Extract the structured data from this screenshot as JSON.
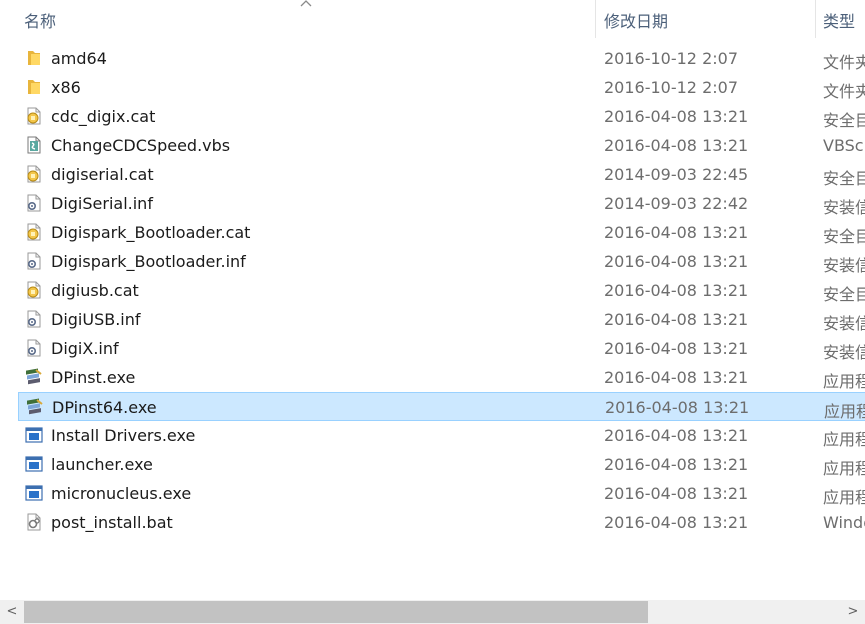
{
  "columns": {
    "name": "名称",
    "date": "修改日期",
    "type": "类型"
  },
  "files": [
    {
      "name": "amd64",
      "date": "2016-10-12 2:07",
      "type": "文件夹",
      "icon": "folder-icon"
    },
    {
      "name": "x86",
      "date": "2016-10-12 2:07",
      "type": "文件夹",
      "icon": "folder-icon"
    },
    {
      "name": "cdc_digix.cat",
      "date": "2016-04-08 13:21",
      "type": "安全目录",
      "icon": "security-catalog-icon"
    },
    {
      "name": "ChangeCDCSpeed.vbs",
      "date": "2016-04-08 13:21",
      "type": "VBScript",
      "icon": "vbscript-icon"
    },
    {
      "name": "digiserial.cat",
      "date": "2014-09-03 22:45",
      "type": "安全目录",
      "icon": "security-catalog-icon"
    },
    {
      "name": "DigiSerial.inf",
      "date": "2014-09-03 22:42",
      "type": "安装信息",
      "icon": "setup-info-icon"
    },
    {
      "name": "Digispark_Bootloader.cat",
      "date": "2016-04-08 13:21",
      "type": "安全目录",
      "icon": "security-catalog-icon"
    },
    {
      "name": "Digispark_Bootloader.inf",
      "date": "2016-04-08 13:21",
      "type": "安装信息",
      "icon": "setup-info-icon"
    },
    {
      "name": "digiusb.cat",
      "date": "2016-04-08 13:21",
      "type": "安全目录",
      "icon": "security-catalog-icon"
    },
    {
      "name": "DigiUSB.inf",
      "date": "2016-04-08 13:21",
      "type": "安装信息",
      "icon": "setup-info-icon"
    },
    {
      "name": "DigiX.inf",
      "date": "2016-04-08 13:21",
      "type": "安装信息",
      "icon": "setup-info-icon"
    },
    {
      "name": "DPinst.exe",
      "date": "2016-04-08 13:21",
      "type": "应用程序",
      "icon": "installer-exe-icon"
    },
    {
      "name": "DPinst64.exe",
      "date": "2016-04-08 13:21",
      "type": "应用程序",
      "icon": "installer-exe-icon",
      "selected": true
    },
    {
      "name": "Install Drivers.exe",
      "date": "2016-04-08 13:21",
      "type": "应用程序",
      "icon": "application-exe-icon"
    },
    {
      "name": "launcher.exe",
      "date": "2016-04-08 13:21",
      "type": "应用程序",
      "icon": "application-exe-icon"
    },
    {
      "name": "micronucleus.exe",
      "date": "2016-04-08 13:21",
      "type": "应用程序",
      "icon": "application-exe-icon"
    },
    {
      "name": "post_install.bat",
      "date": "2016-04-08 13:21",
      "type": "Windows",
      "icon": "batch-file-icon"
    }
  ],
  "scrollbar": {
    "left_arrow": "<",
    "right_arrow": ">",
    "position_fraction": 0.0,
    "visible_fraction": 0.75
  }
}
